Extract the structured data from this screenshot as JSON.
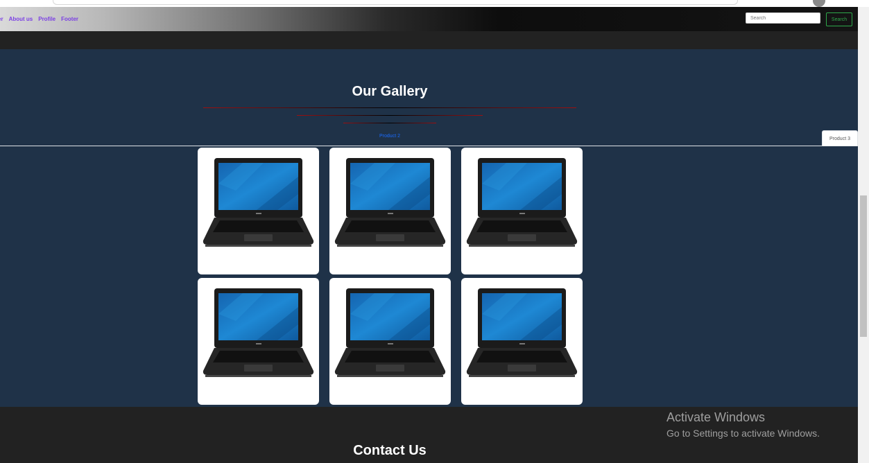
{
  "nav": {
    "links": [
      "er",
      "About us",
      "Profile",
      "Footer"
    ]
  },
  "search": {
    "placeholder": "Search",
    "button_label": "Search"
  },
  "gallery": {
    "title": "Our Gallery",
    "tabs": [
      "Product 2",
      "Product 3"
    ],
    "card_count": 6
  },
  "footer": {
    "title": "Contact Us"
  },
  "watermark": {
    "title": "Activate Windows",
    "subtitle": "Go to Settings to activate Windows."
  },
  "colors": {
    "gallery_bg": "#1f3248",
    "nav_link": "#7b3fe4",
    "search_button": "#2ea84a",
    "tab_active": "#1a6cff"
  }
}
